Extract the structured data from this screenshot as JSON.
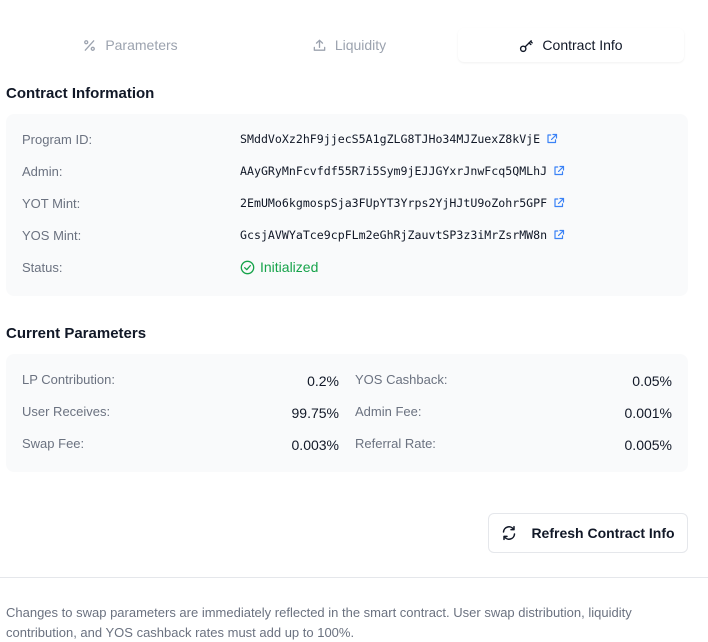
{
  "tabs": [
    {
      "label": "Parameters",
      "icon": "percent-icon",
      "active": false
    },
    {
      "label": "Liquidity",
      "icon": "upload-icon",
      "active": false
    },
    {
      "label": "Contract Info",
      "icon": "key-icon",
      "active": true
    }
  ],
  "contract_info": {
    "title": "Contract Information",
    "rows": [
      {
        "label": "Program ID:",
        "value": "SMddVoXz2hF9jjecS5A1gZLG8TJHo34MJZuexZ8kVjE"
      },
      {
        "label": "Admin:",
        "value": "AAyGRyMnFcvfdf55R7i5Sym9jEJJGYxrJnwFcq5QMLhJ"
      },
      {
        "label": "YOT Mint:",
        "value": "2EmUMo6kgmospSja3FUpYT3Yrps2YjHJtU9oZohr5GPF"
      },
      {
        "label": "YOS Mint:",
        "value": "GcsjAVWYaTce9cpFLm2eGhRjZauvtSP3z3iMrZsrMW8n"
      }
    ],
    "status_label": "Status:",
    "status_value": "Initialized"
  },
  "current_parameters": {
    "title": "Current Parameters",
    "left": [
      {
        "label": "LP Contribution:",
        "value": "0.2%"
      },
      {
        "label": "User Receives:",
        "value": "99.75%"
      },
      {
        "label": "Swap Fee:",
        "value": "0.003%"
      }
    ],
    "right": [
      {
        "label": "YOS Cashback:",
        "value": "0.05%"
      },
      {
        "label": "Admin Fee:",
        "value": "0.001%"
      },
      {
        "label": "Referral Rate:",
        "value": "0.005%"
      }
    ]
  },
  "refresh_button_label": "Refresh Contract Info",
  "footnote": "Changes to swap parameters are immediately reflected in the smart contract. User swap distribution, liquidity contribution, and YOS cashback rates must add up to 100%.",
  "colors": {
    "status_green": "#16a34a",
    "link_blue": "#3b82f6",
    "card_bg": "#f9fafb",
    "muted_text": "#6b7280"
  }
}
